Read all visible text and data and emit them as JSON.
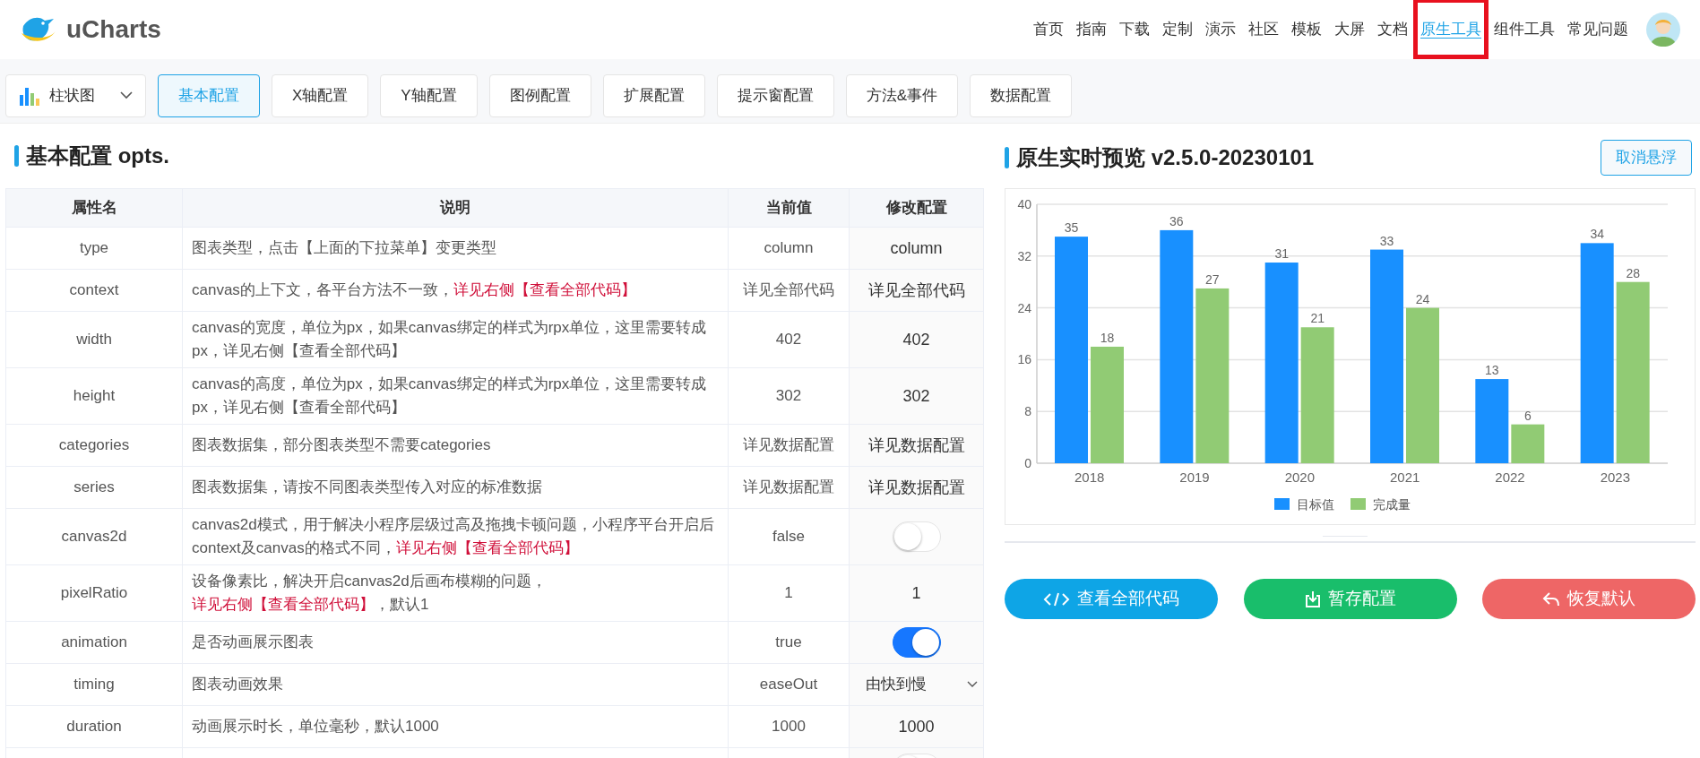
{
  "header": {
    "logo_text": "uCharts",
    "nav": [
      {
        "label": "首页",
        "selected": false,
        "highlighted": false
      },
      {
        "label": "指南",
        "selected": false,
        "highlighted": false
      },
      {
        "label": "下载",
        "selected": false,
        "highlighted": false
      },
      {
        "label": "定制",
        "selected": false,
        "highlighted": false
      },
      {
        "label": "演示",
        "selected": false,
        "highlighted": false
      },
      {
        "label": "社区",
        "selected": false,
        "highlighted": false
      },
      {
        "label": "模板",
        "selected": false,
        "highlighted": false
      },
      {
        "label": "大屏",
        "selected": false,
        "highlighted": false
      },
      {
        "label": "文档",
        "selected": false,
        "highlighted": false
      },
      {
        "label": "原生工具",
        "selected": true,
        "highlighted": true
      },
      {
        "label": "组件工具",
        "selected": false,
        "highlighted": false
      },
      {
        "label": "常见问题",
        "selected": false,
        "highlighted": false
      }
    ]
  },
  "toolbar": {
    "chart_type": "柱状图",
    "tabs": [
      {
        "label": "基本配置",
        "selected": true
      },
      {
        "label": "X轴配置",
        "selected": false
      },
      {
        "label": "Y轴配置",
        "selected": false
      },
      {
        "label": "图例配置",
        "selected": false
      },
      {
        "label": "扩展配置",
        "selected": false
      },
      {
        "label": "提示窗配置",
        "selected": false
      },
      {
        "label": "方法&事件",
        "selected": false
      },
      {
        "label": "数据配置",
        "selected": false
      }
    ]
  },
  "config": {
    "title": "基本配置 opts.",
    "columns": [
      "属性名",
      "说明",
      "当前值",
      "修改配置"
    ],
    "rows": [
      {
        "name": "type",
        "description": [
          {
            "text": "图表类型，点击【上面的下拉菜单】变更类型",
            "link": false
          }
        ],
        "value": "column",
        "kind": "text",
        "setting": "column"
      },
      {
        "name": "context",
        "description": [
          {
            "text": "canvas的上下文，各平台方法不一致，",
            "link": false
          },
          {
            "text": "详见右侧【查看全部代码】",
            "link": true
          }
        ],
        "value": "详见全部代码",
        "kind": "text",
        "setting": "详见全部代码"
      },
      {
        "name": "width",
        "description": [
          {
            "text": "canvas的宽度，单位为px，如果canvas绑定的样式为rpx单位，这里需要转成px，详见右侧【查看全部代码】",
            "link": false
          }
        ],
        "value": "402",
        "kind": "text",
        "setting": "402"
      },
      {
        "name": "height",
        "description": [
          {
            "text": "canvas的高度，单位为px，如果canvas绑定的样式为rpx单位，这里需要转成px，详见右侧【查看全部代码】",
            "link": false
          }
        ],
        "value": "302",
        "kind": "text",
        "setting": "302"
      },
      {
        "name": "categories",
        "description": [
          {
            "text": "图表数据集，部分图表类型不需要categories",
            "link": false
          }
        ],
        "value": "详见数据配置",
        "kind": "text",
        "setting": "详见数据配置"
      },
      {
        "name": "series",
        "description": [
          {
            "text": "图表数据集，请按不同图表类型传入对应的标准数据",
            "link": false
          }
        ],
        "value": "详见数据配置",
        "kind": "text",
        "setting": "详见数据配置"
      },
      {
        "name": "canvas2d",
        "description": [
          {
            "text": "canvas2d模式，用于解决小程序层级过高及拖拽卡顿问题，小程序平台开启后context及canvas的格式不同，",
            "link": false
          },
          {
            "text": "详见右侧【查看全部代码】",
            "link": true
          }
        ],
        "value": "false",
        "kind": "toggle",
        "on": false
      },
      {
        "name": "pixelRatio",
        "description": [
          {
            "text": "设备像素比，解决开启canvas2d后画布模糊的问题，",
            "link": false
          },
          {
            "text": "详见右侧【查看全部代码】",
            "link": true
          },
          {
            "text": "，默认1",
            "link": false
          }
        ],
        "value": "1",
        "kind": "text",
        "setting": "1"
      },
      {
        "name": "animation",
        "description": [
          {
            "text": "是否动画展示图表",
            "link": false
          }
        ],
        "value": "true",
        "kind": "toggle",
        "on": true
      },
      {
        "name": "timing",
        "description": [
          {
            "text": "图表动画效果",
            "link": false
          }
        ],
        "value": "easeOut",
        "kind": "select",
        "setting": "由快到慢"
      },
      {
        "name": "duration",
        "description": [
          {
            "text": "动画展示时长，单位毫秒，默认1000",
            "link": false
          }
        ],
        "value": "1000",
        "kind": "text",
        "setting": "1000"
      },
      {
        "kind": "toggle",
        "on": false
      }
    ]
  },
  "preview": {
    "title": "原生实时预览 v2.5.0-20230101",
    "unfloat_button": "取消悬浮",
    "chart_data": {
      "type": "bar",
      "categories": [
        "2018",
        "2019",
        "2020",
        "2021",
        "2022",
        "2023"
      ],
      "series": [
        {
          "name": "目标值",
          "color": "#1890ff",
          "values": [
            35,
            36,
            31,
            33,
            13,
            34
          ]
        },
        {
          "name": "完成量",
          "color": "#91cb74",
          "values": [
            18,
            27,
            21,
            24,
            6,
            28
          ]
        }
      ],
      "ylim": [
        0,
        40
      ],
      "yticks": [
        0,
        8,
        16,
        24,
        32,
        40
      ],
      "data_labels": true,
      "grid": true,
      "legend": true
    },
    "buttons": [
      {
        "label": "查看全部代码",
        "kind": "code",
        "color": "#0ea5e6"
      },
      {
        "label": "暂存配置",
        "kind": "save",
        "color": "#19be6b"
      },
      {
        "label": "恢复默认",
        "kind": "reset",
        "color": "#ee6666"
      }
    ]
  }
}
